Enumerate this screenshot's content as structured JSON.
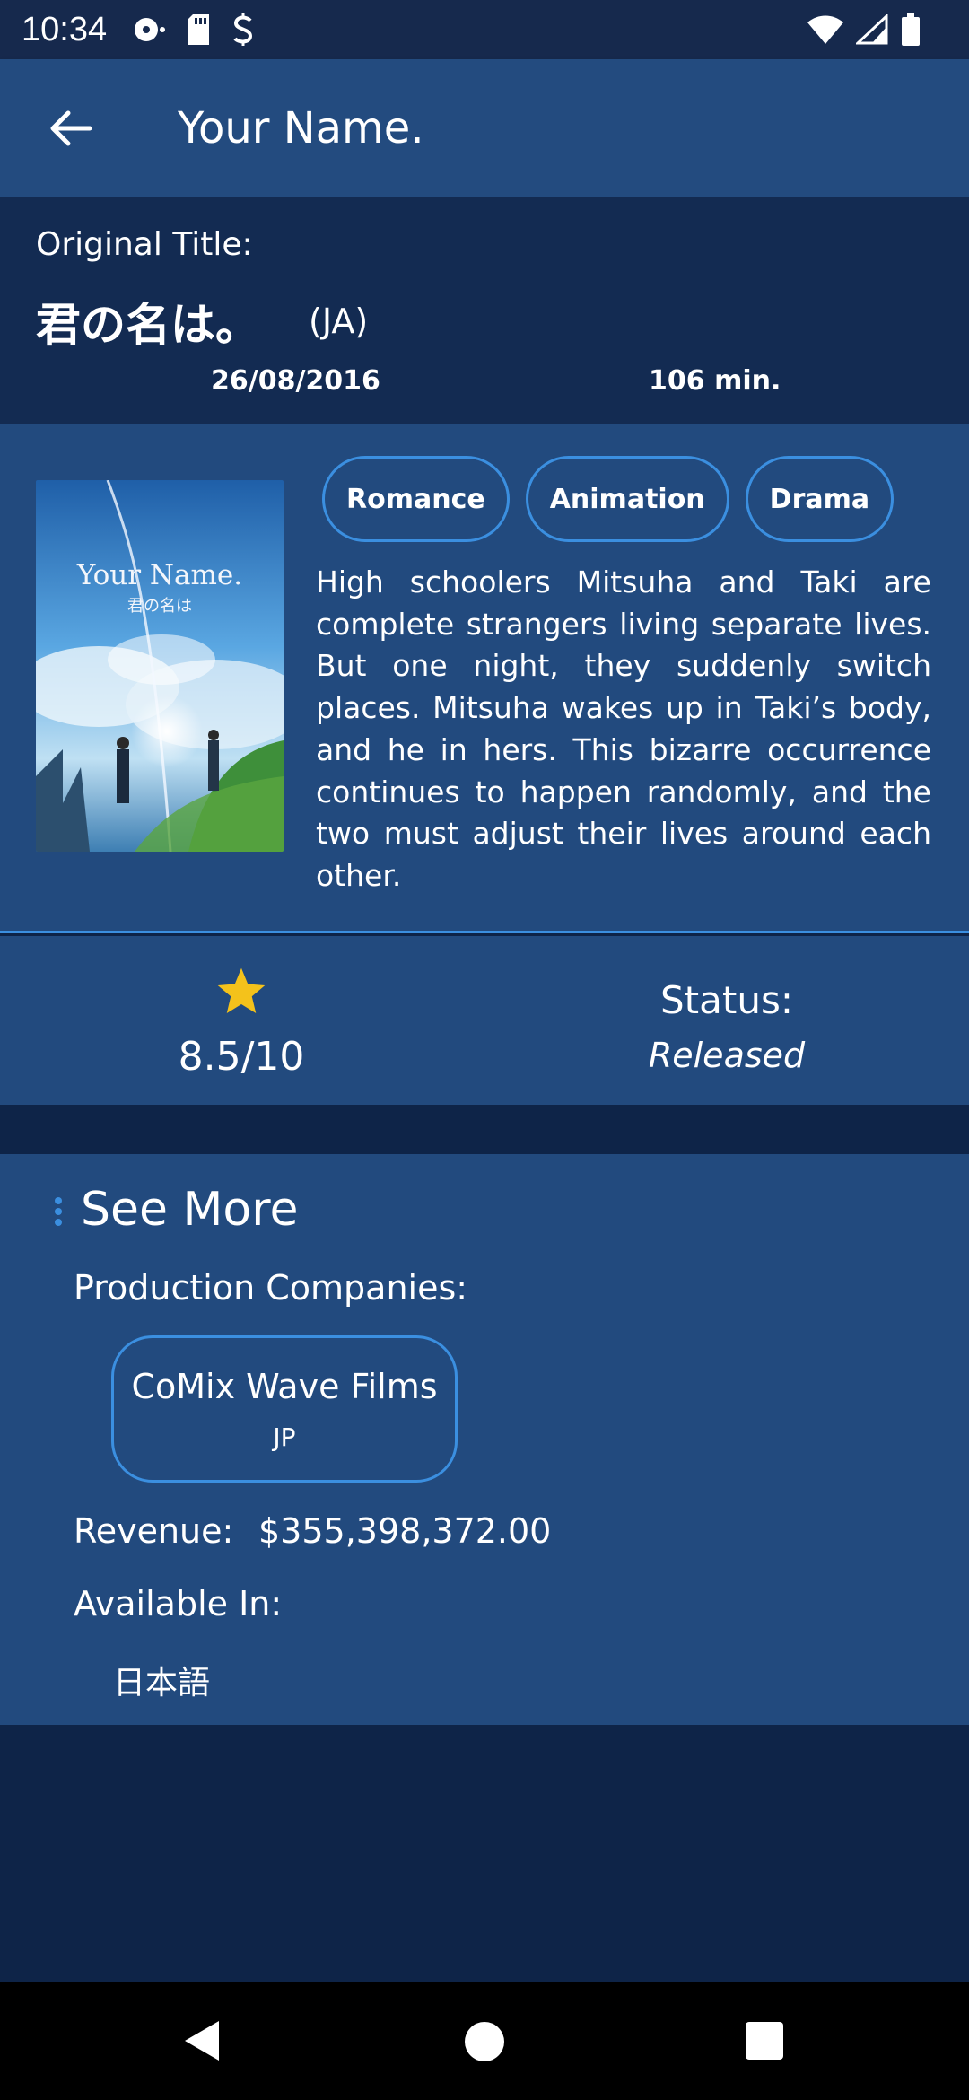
{
  "status_bar": {
    "time": "10:34"
  },
  "app_bar": {
    "title": "Your Name."
  },
  "header": {
    "original_title_label": "Original Title:",
    "original_title": "君の名は。",
    "language_code": "(JA)",
    "release_date": "26/08/2016",
    "runtime": "106 min."
  },
  "poster": {
    "title": "Your Name.",
    "subtitle": "君の名は"
  },
  "genres": [
    "Romance",
    "Animation",
    "Drama"
  ],
  "overview": "High schoolers Mitsuha and Taki are complete strangers living separate lives. But one night, they suddenly switch places. Mitsuha wakes up in Taki’s body, and he in hers. This bizarre occurrence continues to happen randomly, and the two must adjust their lives around each other.",
  "stats": {
    "rating": "8.5/10",
    "status_label": "Status:",
    "status_value": "Released"
  },
  "see_more": {
    "title": "See More",
    "production_label": "Production Companies:",
    "companies": [
      {
        "name": "CoMix Wave Films",
        "country": "JP"
      }
    ],
    "revenue_label": "Revenue:",
    "revenue_value": "$355,398,372.00",
    "available_label": "Available In:",
    "languages": [
      "日本語"
    ]
  },
  "colors": {
    "app_bar": "#234b7f",
    "background": "#0e2448",
    "accent": "#3b8fe0",
    "star": "#f4c21b"
  }
}
